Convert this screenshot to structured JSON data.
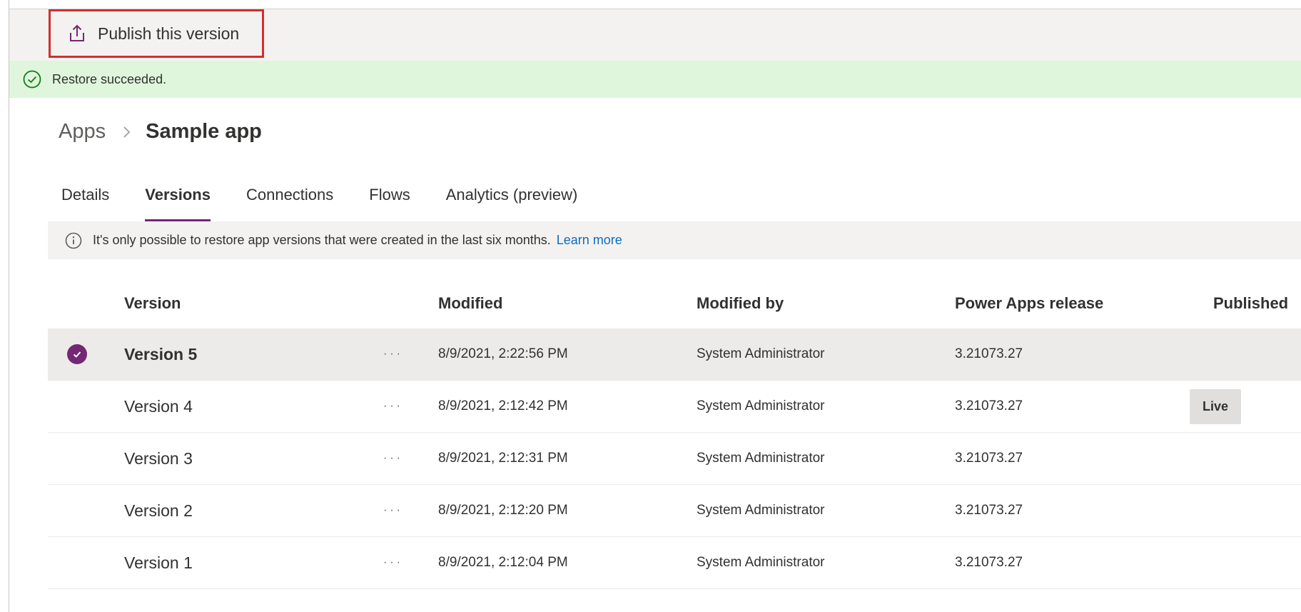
{
  "command_bar": {
    "publish_label": "Publish this version",
    "publish_icon": "upload-icon"
  },
  "message_bar": {
    "text": "Restore succeeded.",
    "icon": "check-circle-icon",
    "color": "#dff6dd"
  },
  "breadcrumb": {
    "parent": "Apps",
    "current": "Sample app",
    "separator_icon": "chevron-right-icon"
  },
  "tabs": [
    {
      "label": "Details",
      "active": false
    },
    {
      "label": "Versions",
      "active": true
    },
    {
      "label": "Connections",
      "active": false
    },
    {
      "label": "Flows",
      "active": false
    },
    {
      "label": "Analytics (preview)",
      "active": false
    }
  ],
  "info_bar": {
    "text": "It's only possible to restore app versions that were created in the last six months.",
    "link": "Learn more",
    "icon": "info-icon"
  },
  "table": {
    "headers": {
      "version": "Version",
      "modified": "Modified",
      "modified_by": "Modified by",
      "release": "Power Apps release",
      "published": "Published"
    },
    "rows": [
      {
        "version": "Version 5",
        "more": "···",
        "modified": "8/9/2021, 2:22:56 PM",
        "modified_by": "System Administrator",
        "release": "3.21073.27",
        "published": "",
        "selected": true
      },
      {
        "version": "Version 4",
        "more": "···",
        "modified": "8/9/2021, 2:12:42 PM",
        "modified_by": "System Administrator",
        "release": "3.21073.27",
        "published": "Live",
        "selected": false
      },
      {
        "version": "Version 3",
        "more": "···",
        "modified": "8/9/2021, 2:12:31 PM",
        "modified_by": "System Administrator",
        "release": "3.21073.27",
        "published": "",
        "selected": false
      },
      {
        "version": "Version 2",
        "more": "···",
        "modified": "8/9/2021, 2:12:20 PM",
        "modified_by": "System Administrator",
        "release": "3.21073.27",
        "published": "",
        "selected": false
      },
      {
        "version": "Version 1",
        "more": "···",
        "modified": "8/9/2021, 2:12:04 PM",
        "modified_by": "System Administrator",
        "release": "3.21073.27",
        "published": "",
        "selected": false
      }
    ]
  },
  "colors": {
    "accent": "#742774",
    "link": "#0f6cbd",
    "highlight_border": "#d32f2f"
  }
}
